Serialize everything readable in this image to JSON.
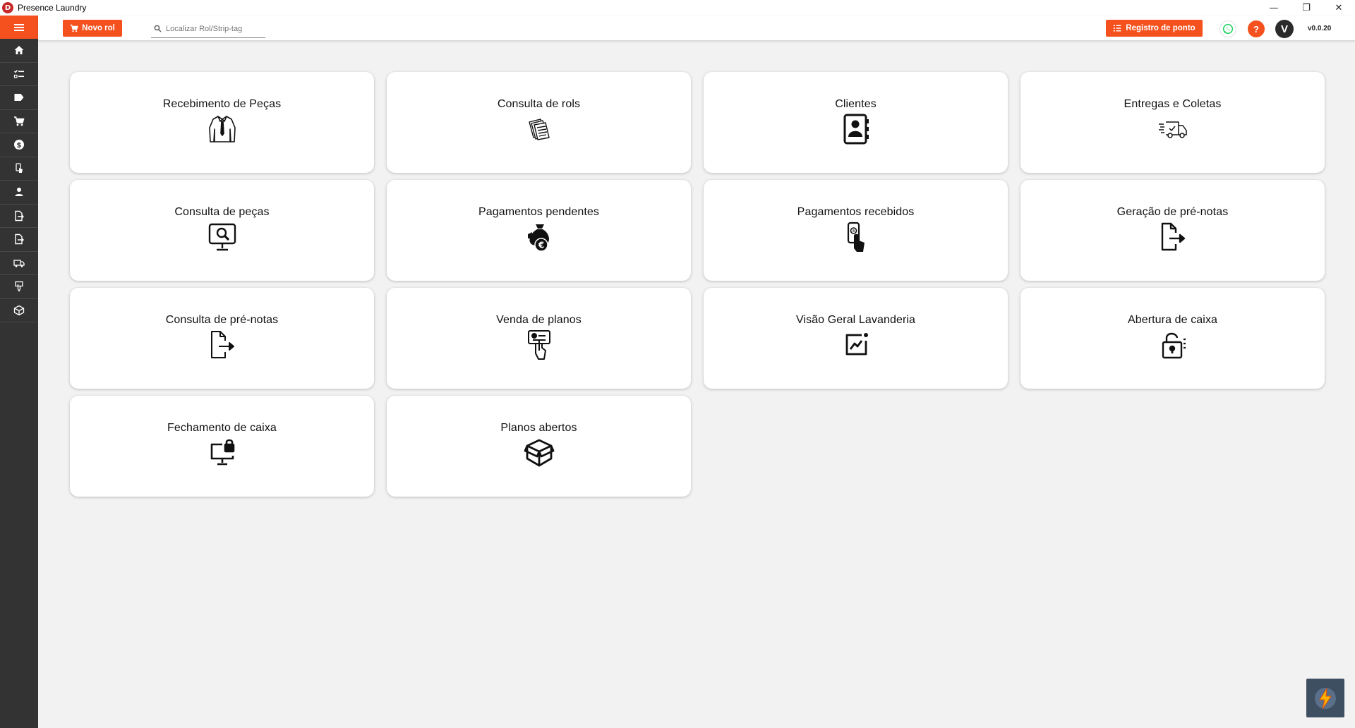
{
  "window": {
    "title": "Presence Laundry",
    "logo_letter": "D",
    "controls": [
      "—",
      "❐",
      "✕"
    ]
  },
  "sidebar": {
    "menu_icon": "hamburger-icon",
    "items": [
      {
        "icon": "home-icon"
      },
      {
        "icon": "checklist-icon"
      },
      {
        "icon": "tag-icon"
      },
      {
        "icon": "cart-icon"
      },
      {
        "icon": "dollar-icon"
      },
      {
        "icon": "hand-touch-icon"
      },
      {
        "icon": "user-icon"
      },
      {
        "icon": "document-export-icon"
      },
      {
        "icon": "document-export-icon"
      },
      {
        "icon": "truck-icon"
      },
      {
        "icon": "plan-sale-icon"
      },
      {
        "icon": "box-icon"
      }
    ]
  },
  "topbar": {
    "novo_rol_label": "Novo rol",
    "search_placeholder": "Localizar Rol/Strip-tag",
    "registro_label": "Registro de ponto",
    "help_label": "?",
    "avatar_letter": "V",
    "version": "v0.0.20",
    "accent": "#f4511e"
  },
  "cards": [
    {
      "label": "Recebimento de Peças",
      "icon": "shirt-icon"
    },
    {
      "label": "Consulta de rols",
      "icon": "papers-icon"
    },
    {
      "label": "Clientes",
      "icon": "contact-book-icon"
    },
    {
      "label": "Entregas e Coletas",
      "icon": "delivery-truck-icon"
    },
    {
      "label": "Consulta de peças",
      "icon": "monitor-search-icon"
    },
    {
      "label": "Pagamentos pendentes",
      "icon": "money-bag-euro-icon"
    },
    {
      "label": "Pagamentos recebidos",
      "icon": "mobile-payment-icon"
    },
    {
      "label": "Geração de pré-notas",
      "icon": "file-export-icon"
    },
    {
      "label": "Consulta de pré-notas",
      "icon": "file-export-outline-icon"
    },
    {
      "label": "Venda de planos",
      "icon": "card-hand-icon"
    },
    {
      "label": "Visão Geral Lavanderia",
      "icon": "chart-frame-icon"
    },
    {
      "label": "Abertura de caixa",
      "icon": "lock-open-icon"
    },
    {
      "label": "Fechamento de caixa",
      "icon": "monitor-lock-icon"
    },
    {
      "label": "Planos abertos",
      "icon": "open-box-icon"
    }
  ],
  "corner_badge_icon": "lightning-icon"
}
